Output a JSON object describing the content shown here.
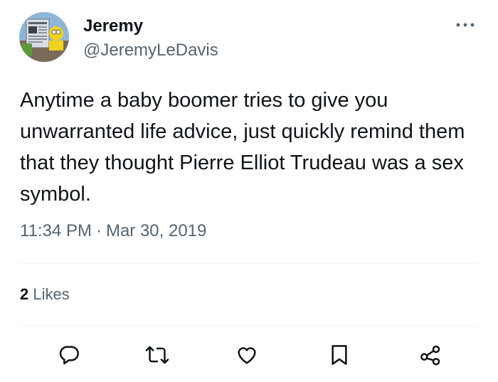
{
  "author": {
    "name": "Jeremy",
    "handle": "@JeremyLeDavis"
  },
  "tweet": {
    "text_lines": [
      "Anytime a baby boomer tries to give you",
      "unwarranted life advice, just quickly remind them",
      "that they thought Pierre Elliot Trudeau was a sex",
      "symbol."
    ],
    "time": "11:34 PM",
    "separator": "·",
    "date": "Mar 30, 2019"
  },
  "stats": {
    "likes_count": "2",
    "likes_label": "Likes"
  },
  "actions": {
    "reply": "reply-icon",
    "retweet": "retweet-icon",
    "like": "heart-icon",
    "bookmark": "bookmark-icon",
    "share": "share-icon"
  },
  "colors": {
    "text_primary": "#0f1419",
    "text_secondary": "#536471",
    "divider": "#eff3f4"
  }
}
